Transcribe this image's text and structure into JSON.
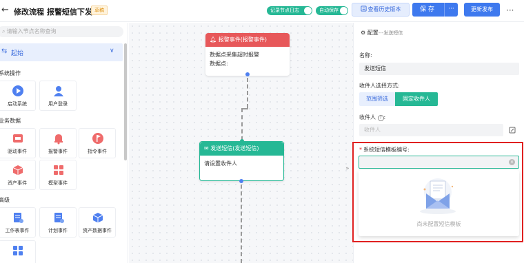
{
  "header": {
    "back_icon": "arrow-left-icon",
    "title": "修改流程 报警短信下发",
    "draft_badge": "草稿",
    "record_log_label": "记录节点日志",
    "auto_save_label": "自动保存",
    "history_button": "查看历史版本",
    "save_button": "保存",
    "save_more": "···",
    "publish_button": "更新发布",
    "more_icon": "···"
  },
  "sidebar": {
    "search_placeholder": "请输入节点名称查询",
    "section_label": "起始",
    "categories": [
      {
        "name": "系统操作",
        "items": [
          {
            "label": "启动系统",
            "icon": "play-circle-icon"
          },
          {
            "label": "用户登录",
            "icon": "user-icon"
          }
        ]
      },
      {
        "name": "业务数据",
        "items": [
          {
            "label": "驱动事件",
            "icon": "drive-event-icon"
          },
          {
            "label": "报警事件",
            "icon": "bell-icon"
          },
          {
            "label": "指令事件",
            "icon": "flag-icon"
          },
          {
            "label": "资产事件",
            "icon": "cube-icon"
          },
          {
            "label": "模型事件",
            "icon": "grid-icon"
          }
        ]
      },
      {
        "name": "高级",
        "items": [
          {
            "label": "工作表事件",
            "icon": "worksheet-icon"
          },
          {
            "label": "计划事件",
            "icon": "plan-icon"
          },
          {
            "label": "资产数据事件",
            "icon": "asset-data-icon"
          },
          {
            "label": "",
            "icon": "grid-icon"
          }
        ]
      }
    ]
  },
  "canvas": {
    "alarm_node": {
      "title": "报警事件(报警事件)",
      "lines": [
        "数据点采集超时报警",
        "数据点:"
      ]
    },
    "sms_node": {
      "title": "发送短信(发送短信)",
      "body": "请设置收件人"
    },
    "collapse_icon": "»"
  },
  "config": {
    "header": "配置",
    "header_sub": "---发送短信",
    "name_label": "名称:",
    "name_value": "发送短信",
    "recipient_mode_label": "收件人选择方式:",
    "mode_options": [
      "范围筛选",
      "固定收件人"
    ],
    "mode_selected": "固定收件人",
    "recipient_label": "收件人",
    "recipient_placeholder": "收件人",
    "template_label": "系统短信模板编号:",
    "template_value": "",
    "empty_text": "尚未配置短信模板"
  },
  "colors": {
    "primary": "#3e79ee",
    "green": "#26b895",
    "alarm_red": "#e7585a",
    "highlight_red": "#e02020"
  }
}
